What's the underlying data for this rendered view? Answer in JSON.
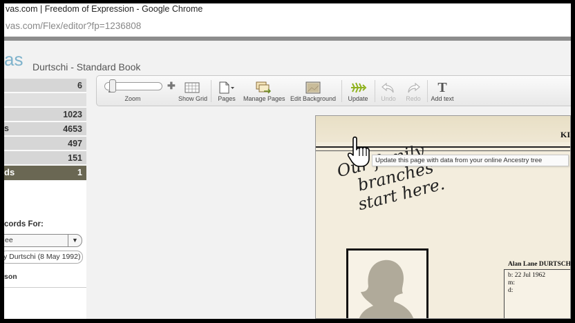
{
  "browser": {
    "title": "vas.com | Freedom of Expression - Google Chrome",
    "url_domain": "vas.com",
    "url_path": "/Flex/editor?fp=1236808"
  },
  "app": {
    "logo_text": "as",
    "book_title": "Durtschi - Standard Book",
    "accent_color": "#7fb3cc"
  },
  "sidebar": {
    "rows": [
      {
        "label": "",
        "value": "6"
      },
      {
        "label": "",
        "value": ""
      },
      {
        "label": "",
        "value": "1023"
      },
      {
        "label": "s",
        "value": "4653"
      },
      {
        "label": "",
        "value": "497"
      },
      {
        "label": "",
        "value": "151"
      },
      {
        "label": "ds",
        "value": "1"
      }
    ],
    "records_label": "cords For:",
    "select_value": "ee",
    "person_value": "y Durtschi (8 May 1992)",
    "son_label": "son"
  },
  "toolbar": {
    "zoom": "Zoom",
    "show_grid": "Show Grid",
    "pages": "Pages",
    "manage_pages": "Manage Pages",
    "edit_background": "Edit Background",
    "update": "Update",
    "undo": "Undo",
    "redo": "Redo",
    "add_text": "Add text"
  },
  "tooltip": {
    "text": "Update this page with data from your online Ancestry tree"
  },
  "page": {
    "header_fragment": "KI",
    "script_lines": [
      "Our family",
      "branches",
      "start here."
    ],
    "person_name": "Alan Lane DURTSCH",
    "born": "b: 22 Jul 1962",
    "married": "m:",
    "died": "d:"
  }
}
